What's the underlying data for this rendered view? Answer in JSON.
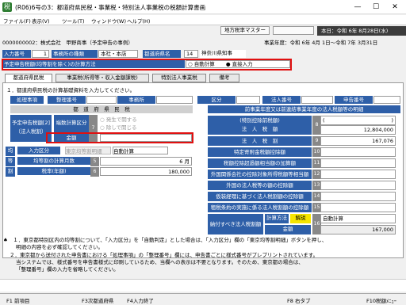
{
  "window": {
    "title": "(R06)6号の3：都道府県民税・事業税・特別法人事業税の税額計算書画",
    "icon": "税",
    "min": "—",
    "max": "☐",
    "close": "✕"
  },
  "menu": [
    "ファイル(F)",
    "表示(V)",
    "ツール(T)",
    "ウィンドウ(W)",
    "ヘルプ(H)"
  ],
  "toolbar": {
    "btn1": "地方税率マスター",
    "btn2": "",
    "date": "本日：令和 6年 8月28日(水)"
  },
  "header": {
    "company": "0000000002：株式会社　甲野商事（予定申告の事例）",
    "period": "事業年度：令和 6年 4月 1日～令和 7年 3月31日"
  },
  "row1": {
    "l1": "入力番号",
    "v1": "1",
    "l2": "事務所の種類",
    "v2": "本社・本店",
    "l3": "都道府県名",
    "v3": "14",
    "v4": "神奈川県知事"
  },
  "row2": {
    "label": "予定申告税額(均等割を除く)の計算方法",
    "opt1": "自動計算",
    "opt2": "直接入力"
  },
  "tabs": [
    "都道府県民税",
    "事業税(所得等・収入金額課税)",
    "特別法人事業税",
    "備考"
  ],
  "section_title": "１．都道府県民税の計算基礎資料を入力してください。",
  "left": {
    "shori": "処理事項",
    "seiri": "整理番号",
    "jimusho": "事務所",
    "kenmei": "都　道　府　県　民　税",
    "yotei": "予定申告税額[2]（法人税割）",
    "kubun": "端数計算区分",
    "opt_a": "○ 発生で開する",
    "opt_b": "○ 除しで開じる",
    "kingaku_lbl": "金額",
    "kin_num": "7",
    "nyuryoku": "入力区分",
    "nyuryoku_v": "東京均等割明細",
    "jidou": "自動計算",
    "kin_lbl": "均",
    "to_lbl": "等",
    "wari_lbl": "割",
    "r5": "均等割の計算月数",
    "r5n": "5",
    "r5v": "6 月",
    "r6": "税率(年額)",
    "r6n": "6",
    "r6v": "180,000"
  },
  "right": {
    "ku": "区分",
    "hojin": "法人番号",
    "kofu": "申告番号",
    "header": "前事業年度又は前連結事業年度の法人税額等の明細",
    "r8a": "(特別控除前税額)",
    "r8b": "法　人　税　額",
    "r8n": "8",
    "r8v1": "(",
    "r8v2": ")",
    "r8v3": "12,804,000",
    "r9": "法　人　税　割",
    "r9n": "9",
    "r9v": "167,076",
    "r10": "特定寄附金税額控除額",
    "r10n": "10",
    "r11": "税額控除超過額相当額の加算額",
    "r11n": "11",
    "r12": "外国関係会社の控除対象所得税額等相当額",
    "r12n": "12",
    "r13": "外国の法人税等の額の控除額",
    "r13n": "13",
    "r14": "仮装経理に基づく法人税割額の控除額",
    "r14n": "14",
    "r15": "租税条約の実施に係る法人税割額の控除額",
    "r15n": "15",
    "r16": "納付すべき法人税割額",
    "r16n": "16",
    "keisan": "計算方法",
    "kaisetsu": "解説",
    "jidou": "自動計算",
    "kingaku": "金額",
    "kingaku_v": "167,000"
  },
  "notes": {
    "n1": "♠　１．東京都特別区内の均等割について、「入力区分」を「自動判定」とした場合は、「入力区分」欄の「東京均等割明細」ボタンを押し、",
    "n1b": "明細の内容を必ず確認してください。",
    "n2": "２．東京都から送付された申告書における「処理事項」の「整理番号」欄には、申告書ごとに様式番号がプレプリントされています。",
    "n2b": "当システムでは、様式番号を申告書様式に印刷しているため、当欄への表示は不要となります。そのため、東京都の場合は、",
    "n2c": "「整理番号」欄の入力を省略してください。"
  },
  "fkeys": [
    "F1 前項目",
    "F3次都道府県",
    "F4入力終了",
    "F8 右タブ",
    "F10税額ﾒﾆｭｰ"
  ],
  "colors": {
    "accent": "#2e5fa8",
    "highlight": "#e01010"
  }
}
